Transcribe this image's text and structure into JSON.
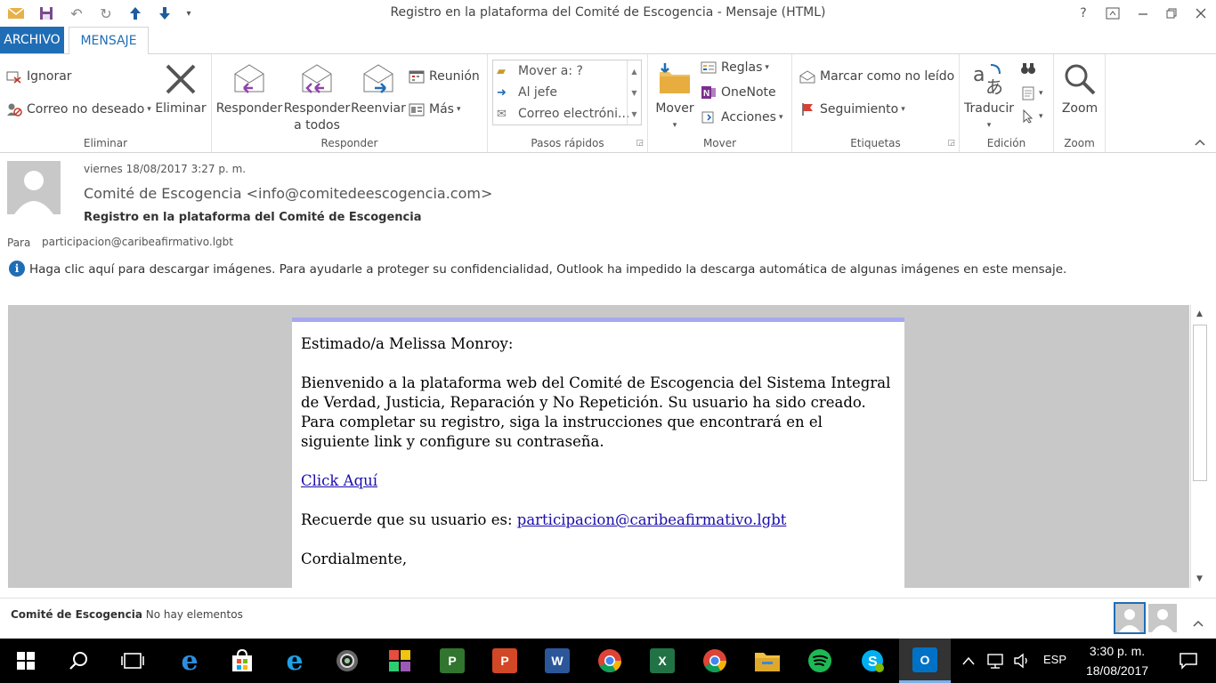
{
  "window": {
    "title": "Registro en la plataforma del Comité de Escogencia - Mensaje (HTML)",
    "help": "?"
  },
  "tabs": {
    "file": "ARCHIVO",
    "message": "MENSAJE"
  },
  "ribbon": {
    "delete_group": {
      "label": "Eliminar",
      "ignore": "Ignorar",
      "junk": "Correo no deseado",
      "delete": "Eliminar"
    },
    "respond_group": {
      "label": "Responder",
      "reply": "Responder",
      "reply_all_1": "Responder",
      "reply_all_2": "a todos",
      "forward": "Reenviar",
      "meeting": "Reunión",
      "more": "Más"
    },
    "quick_steps": {
      "label": "Pasos rápidos",
      "items": [
        "Mover a: ?",
        "Al jefe",
        "Correo electróni..."
      ]
    },
    "move_group": {
      "label": "Mover",
      "move": "Mover",
      "rules": "Reglas",
      "onenote": "OneNote",
      "actions": "Acciones"
    },
    "tags_group": {
      "label": "Etiquetas",
      "mark_unread": "Marcar como no leído",
      "follow_up": "Seguimiento"
    },
    "editing_group": {
      "label": "Edición",
      "translate": "Traducir"
    },
    "zoom_group": {
      "label": "Zoom",
      "zoom": "Zoom"
    }
  },
  "message": {
    "date": "viernes 18/08/2017 3:27 p. m.",
    "from": "Comité de Escogencia <info@comitedeescogencia.com>",
    "subject": "Registro en la plataforma del Comité de Escogencia",
    "to_label": "Para",
    "to": "participacion@caribeafirmativo.lgbt",
    "info_bar": "Haga clic aquí para descargar imágenes. Para ayudarle a proteger su confidencialidad, Outlook ha impedido la descarga automática de algunas imágenes en este mensaje.",
    "body": {
      "greeting": "Estimado/a Melissa Monroy:",
      "paragraph": "Bienvenido a la plataforma web del Comité de Escogencia del Sistema Integral de Verdad, Justicia, Reparación y No Repetición. Su usuario ha sido creado. Para completar su registro, siga la instrucciones que encontrará en el siguiente link y configure su contraseña.",
      "link": "Click Aquí",
      "user_prefix": "Recuerde que su usuario es: ",
      "user_email": "participacion@caribeafirmativo.lgbt",
      "closing": "Cordialmente,"
    }
  },
  "people_pane": {
    "name": "Comité de Escogencia",
    "status": "No hay elementos"
  },
  "taskbar": {
    "language": "ESP",
    "time": "3:30 p. m.",
    "date": "18/08/2017"
  },
  "colors": {
    "accent": "#1f6db5",
    "body_bg": "#c8c8c8",
    "card_top_border": "#a8a8f0",
    "link": "#1a0dab"
  }
}
